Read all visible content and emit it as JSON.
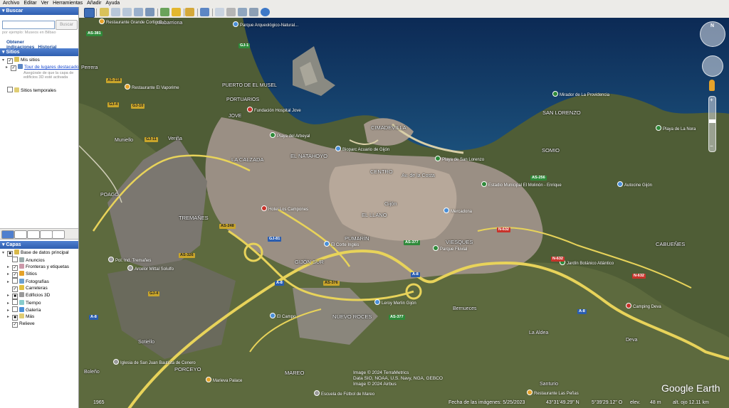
{
  "menu": [
    "Archivo",
    "Editar",
    "Ver",
    "Herramientas",
    "Añadir",
    "Ayuda"
  ],
  "search": {
    "title": "Buscar",
    "value": "",
    "button": "Buscar",
    "hint": "por ejemplo: Museos en Bilbao",
    "link_directions": "Obtener indicaciones",
    "link_history": "Historial"
  },
  "places": {
    "title": "Sitios",
    "items": [
      {
        "label": "Mis sitios",
        "checked": true
      },
      {
        "label": "Tour de lugares destacados",
        "checked": true
      },
      {
        "label": "Asegúrate de que la capa de edificios 3D esté activada",
        "checked": null
      },
      {
        "label": "Sitios temporales",
        "checked": false
      }
    ]
  },
  "layers": {
    "title": "Capas",
    "items": [
      {
        "label": "Base de datos principal",
        "checked": true
      },
      {
        "label": "Anuncios",
        "checked": false
      },
      {
        "label": "Fronteras y etiquetas",
        "checked": true
      },
      {
        "label": "Sitios",
        "checked": true
      },
      {
        "label": "Fotografías",
        "checked": false
      },
      {
        "label": "Carreteras",
        "checked": true
      },
      {
        "label": "Edificios 3D",
        "checked": false
      },
      {
        "label": "Tiempo",
        "checked": false
      },
      {
        "label": "Galería",
        "checked": false
      },
      {
        "label": "Más",
        "checked": false
      },
      {
        "label": "Relieve",
        "checked": true
      }
    ]
  },
  "map": {
    "places": [
      "Sabarriona",
      "Perrera",
      "PUERTO DE EL MUSEL",
      "PORTUARIOS",
      "JOVE",
      "Muniello",
      "Veriña",
      "POAGO",
      "LA CALZADA",
      "EL NATAHOYO",
      "CIMADEVILLA",
      "CENTRO",
      "Av. de la Costa",
      "Gijón",
      "EL LLANO",
      "TREMAÑES",
      "PUMARÍN",
      "GIJÓN SUR",
      "VIESQUES",
      "NUEVO ROCES",
      "Bernueces",
      "SAN LORENZO",
      "SOMIO",
      "CABUEÑES",
      "La Aldea",
      "Deva",
      "Sotiello",
      "PORCEYO",
      "MAREO",
      "Santurio",
      "Boleño"
    ],
    "pois": [
      "Restaurante Grande Cortiguil",
      "Parque Arqueológico-Natural...",
      "Restaurante El Vaporime",
      "Fundación Hospital Jove",
      "Playa del Arbeyal",
      "Bioparc Acuario de Gijón",
      "Playa de San Lorenzo",
      "Mirador de La Providencia",
      "Playa de La Nora",
      "Estadio Municipal El Molinón - Enrique",
      "Autocine Gijón",
      "Hotel Los Campones",
      "El Corte Inglés",
      "Mercadona",
      "Parque Fluvial",
      "Jardín Botánico Atlántico",
      "Pol. Ind. Tremañes",
      "Arcelor Mittal Solulfo",
      "Leroy Merlin Gijón",
      "Camping Deva",
      "Iglesia de San Juan Bautista de Cenero",
      "Marieva Palace",
      "Escuela de Fútbol de Mareo",
      "Restaurante Las Peñas",
      "El Campo"
    ],
    "roads": [
      "AS-381",
      "GJ-1",
      "AS-118",
      "GJ-10",
      "GJ-4",
      "GJ-11",
      "AS-376",
      "AS-377",
      "AS-248",
      "GJ-81",
      "AS-326",
      "A-8",
      "N-632",
      "AS-376",
      "AS-377",
      "A-8",
      "AS-256",
      "A-8",
      "GJ-4",
      "AS-247",
      "AS-18",
      "AS-379"
    ],
    "credits": [
      "Image © 2024 TerraMetrics",
      "Data SIO, NOAA, U.S. Navy, NGA, GEBCO",
      "Image © 2024 Airbus"
    ],
    "logo": "Google Earth",
    "status": {
      "year": "1965",
      "date": "Fecha de las imágenes: 5/25/2023",
      "lat": "43°31'49.29\" N",
      "lon": "5°39'29.12\" O",
      "elev_label": "elev.",
      "elev": "48 m",
      "eye": "alt. ojo  12.11 km"
    }
  }
}
